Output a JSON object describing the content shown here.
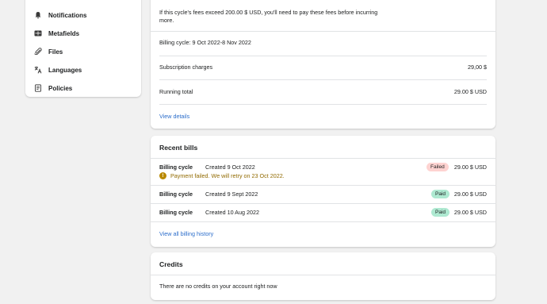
{
  "sidebar": {
    "items": [
      {
        "label": "Notifications",
        "icon": "bell-icon"
      },
      {
        "label": "Metafields",
        "icon": "metafields-icon"
      },
      {
        "label": "Files",
        "icon": "paperclip-icon"
      },
      {
        "label": "Languages",
        "icon": "translate-icon"
      },
      {
        "label": "Policies",
        "icon": "policy-icon"
      }
    ]
  },
  "current_bill": {
    "notice_line1": "If this cycle's fees exceed 200.00 $ USD, you'll need to pay these fees before incurring",
    "notice_line2": "more.",
    "cycle_label": "Billing cycle: 9 Oct 2022-8 Nov 2022",
    "subscription_label": "Subscription charges",
    "subscription_value": "29,00 $",
    "running_label": "Running total",
    "running_value": "29.00 $ USD",
    "details_link": "View details"
  },
  "recent_bills": {
    "title": "Recent bills",
    "rows": [
      {
        "cycle": "Billing cycle",
        "created": "Created 9 Oct 2022",
        "status": "Failed",
        "amount": "29.00 $ USD"
      },
      {
        "cycle": "Billing cycle",
        "created": "Created 9 Sept 2022",
        "status": "Paid",
        "amount": "29.00 $ USD"
      },
      {
        "cycle": "Billing cycle",
        "created": "Created 10 Aug 2022",
        "status": "Paid",
        "amount": "29.00 $ USD"
      }
    ],
    "warning": "Payment failed. We will retry on 23 Oct 2022.",
    "history_link": "View all billing history"
  },
  "credits": {
    "title": "Credits",
    "empty_text": "There are no credits on your account right now"
  },
  "colors": {
    "link": "#2c6ecb",
    "failed_badge": "#fed3d1",
    "paid_badge": "#aee9d1",
    "warning_text": "#916a00"
  }
}
